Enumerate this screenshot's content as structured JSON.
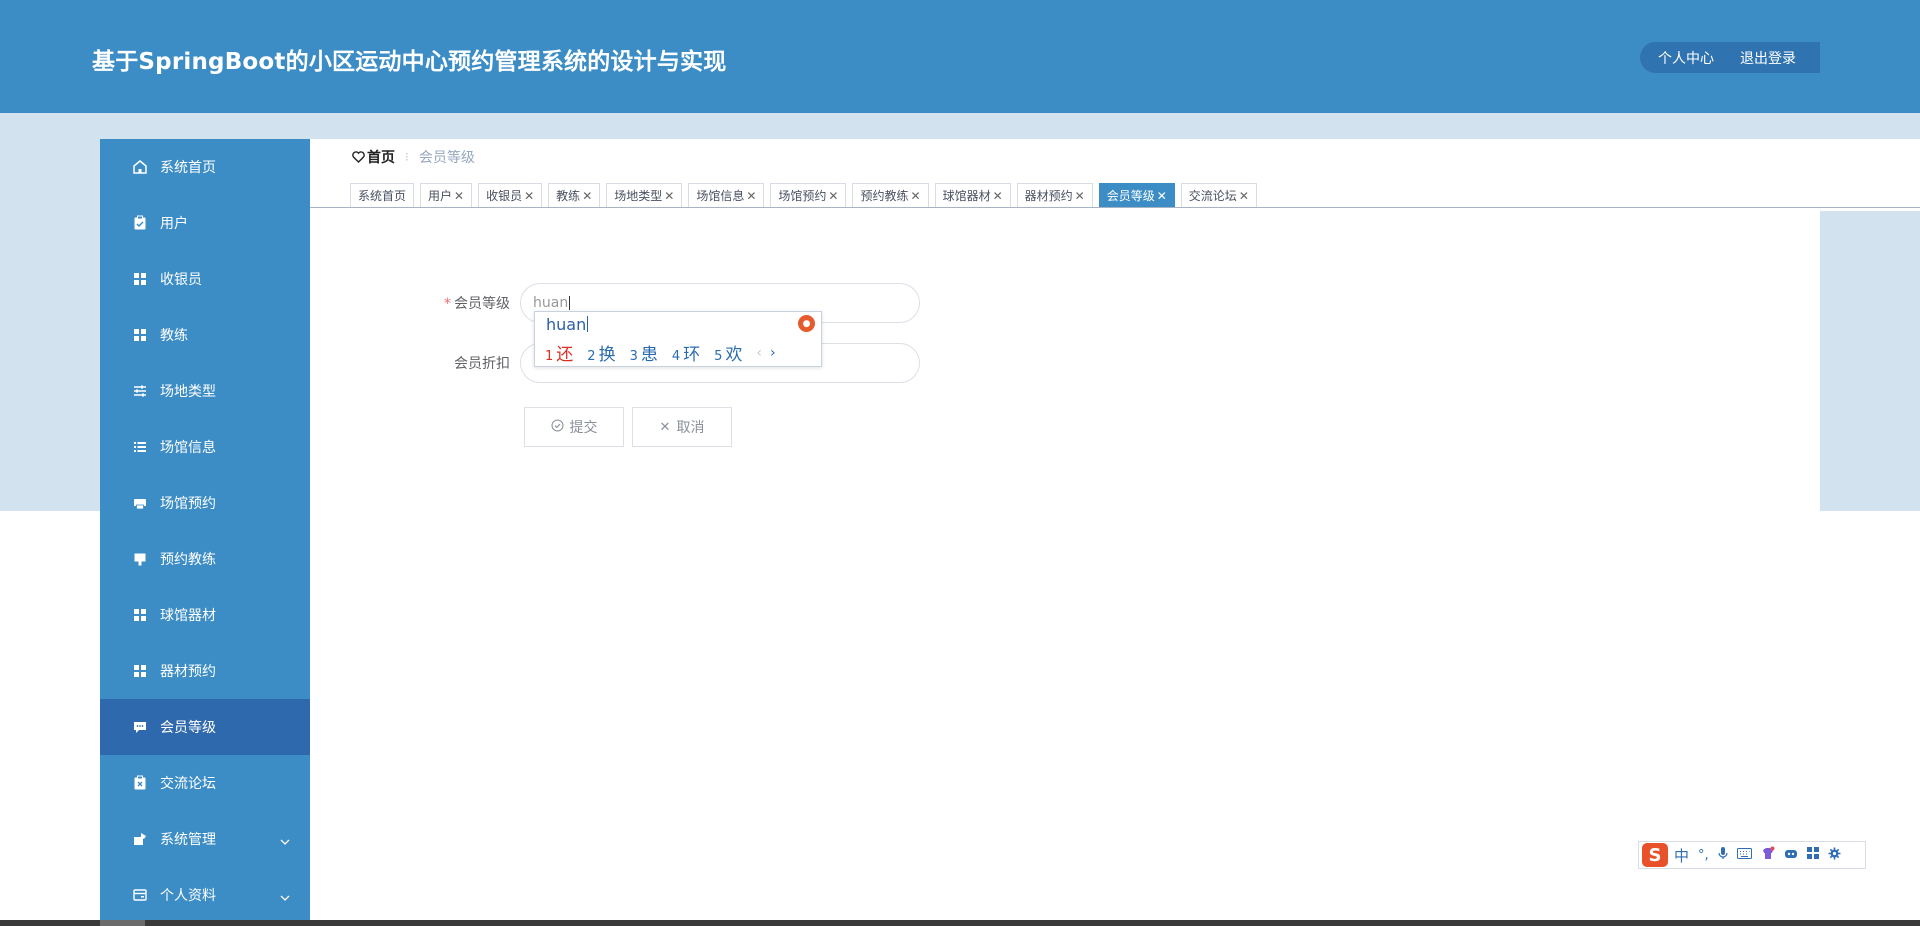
{
  "header": {
    "title": "基于SpringBoot的小区运动中心预约管理系统的设计与实现",
    "profile_label": "个人中心",
    "logout_label": "退出登录"
  },
  "sidebar": {
    "items": [
      {
        "label": "系统首页",
        "icon": "home-icon"
      },
      {
        "label": "用户",
        "icon": "clipboard-icon"
      },
      {
        "label": "收银员",
        "icon": "grid-icon"
      },
      {
        "label": "教练",
        "icon": "grid-icon"
      },
      {
        "label": "场地类型",
        "icon": "sliders-icon"
      },
      {
        "label": "场馆信息",
        "icon": "list-icon"
      },
      {
        "label": "场馆预约",
        "icon": "printer-icon"
      },
      {
        "label": "预约教练",
        "icon": "chalkboard-icon"
      },
      {
        "label": "球馆器材",
        "icon": "grid-icon"
      },
      {
        "label": "器材预约",
        "icon": "grid-icon"
      },
      {
        "label": "会员等级",
        "icon": "chat-icon"
      },
      {
        "label": "交流论坛",
        "icon": "clipboard-x-icon"
      },
      {
        "label": "系统管理",
        "icon": "settings-icon"
      },
      {
        "label": "个人资料",
        "icon": "card-icon"
      }
    ],
    "active_label": "会员等级"
  },
  "breadcrumb": {
    "home": "首页",
    "separator": "⁝",
    "current": "会员等级"
  },
  "tabs": [
    {
      "label": "系统首页",
      "closable": false
    },
    {
      "label": "用户",
      "closable": true
    },
    {
      "label": "收银员",
      "closable": true
    },
    {
      "label": "教练",
      "closable": true
    },
    {
      "label": "场地类型",
      "closable": true
    },
    {
      "label": "场馆信息",
      "closable": true
    },
    {
      "label": "场馆预约",
      "closable": true
    },
    {
      "label": "预约教练",
      "closable": true
    },
    {
      "label": "球馆器材",
      "closable": true
    },
    {
      "label": "器材预约",
      "closable": true
    },
    {
      "label": "会员等级",
      "closable": true,
      "active": true
    },
    {
      "label": "交流论坛",
      "closable": true
    }
  ],
  "form": {
    "level_label": "会员等级",
    "level_value": "huan",
    "discount_label": "会员折扣",
    "discount_value": "",
    "submit_label": "提交",
    "cancel_label": "取消"
  },
  "ime": {
    "composition": "huan",
    "candidates": [
      {
        "num": "1",
        "text": "还"
      },
      {
        "num": "2",
        "text": "换"
      },
      {
        "num": "3",
        "text": "患"
      },
      {
        "num": "4",
        "text": "环"
      },
      {
        "num": "5",
        "text": "欢"
      }
    ],
    "prev": "‹",
    "next": "›",
    "toolbar": {
      "logo": "S",
      "lang": "中",
      "punct": "°,"
    }
  },
  "colors": {
    "primary": "#3c8dc6",
    "sidebar_active": "#2f69ad",
    "band": "#d2e2ef",
    "required": "#f56c6c"
  }
}
